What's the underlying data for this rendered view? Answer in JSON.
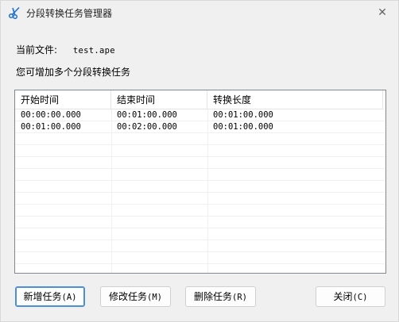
{
  "window": {
    "title": "分段转换任务管理器",
    "close_glyph": "✕"
  },
  "file": {
    "label": "当前文件:",
    "value": "test.ape"
  },
  "hint": "您可增加多个分段转换任务",
  "table": {
    "columns": [
      "开始时间",
      "结束时间",
      "转换长度"
    ],
    "rows": [
      [
        "00:00:00.000",
        "00:01:00.000",
        "00:01:00.000"
      ],
      [
        "00:01:00.000",
        "00:02:00.000",
        "00:01:00.000"
      ]
    ]
  },
  "buttons": {
    "add_label": "新增任务",
    "add_key": "(A)",
    "edit_label": "修改任务",
    "edit_key": "(M)",
    "delete_label": "删除任务",
    "delete_key": "(R)",
    "close_label": "关闭",
    "close_key": "(C)"
  },
  "colors": {
    "focus_border": "#4b8fd6",
    "icon_blue": "#1e6fd0"
  }
}
